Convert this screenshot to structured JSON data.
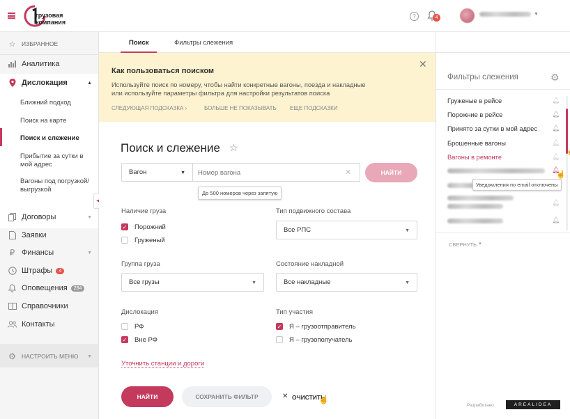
{
  "header": {
    "logo_line1": "грузовая",
    "logo_line2": "компания",
    "notification_count": "4"
  },
  "sidebar": {
    "favorites": "ИЗБРАННОЕ",
    "analytics": "Аналитика",
    "dislocation": "Дислокация",
    "sub": [
      "Ближний подход",
      "Поиск на карте",
      "Поиск и слежение",
      "Прибытие за сутки в мой адрес",
      "Вагоны под погрузкой/выгрузкой"
    ],
    "contracts": "Договоры",
    "requests": "Заявки",
    "finance": "Финансы",
    "fines": "Штрафы",
    "fines_count": "4",
    "alerts": "Оповещения",
    "alerts_count": "284",
    "reference": "Справочники",
    "contacts": "Контакты",
    "configure_menu": "НАСТРОИТЬ МЕНЮ"
  },
  "tabs": [
    "Поиск",
    "Фильтры слежения"
  ],
  "hint": {
    "title": "Как пользоваться поиском",
    "text1": "Используйте поиск по номеру, чтобы найти конкретные вагоны, поезда и накладные",
    "text2": "или используйте параметры фильтра для настройки результатов поиска",
    "next": "СЛЕДУЮЩАЯ ПОДСКАЗКА ›",
    "hide": "БОЛЬШЕ НЕ ПОКАЗЫВАТЬ",
    "more": "ЕЩЕ ПОДСКАЗКИ"
  },
  "search": {
    "title": "Поиск и слежение",
    "type_value": "Вагон",
    "placeholder": "Номер вагона",
    "find": "НАЙТИ",
    "tooltip": "До 500 номеров через запятую"
  },
  "form": {
    "cargo_presence_label": "Наличие груза",
    "cargo_empty": "Порожний",
    "cargo_loaded": "Груженый",
    "rolling_stock_label": "Тип подвижного состава",
    "rolling_stock_value": "Все РПС",
    "cargo_group_label": "Группа груза",
    "cargo_group_value": "Все грузы",
    "waybill_label": "Состояние накладной",
    "waybill_value": "Все накладные",
    "dislocation_label": "Дислокация",
    "disl_rf": "РФ",
    "disl_outside": "Вне РФ",
    "participation_label": "Тип участия",
    "part_sender": "Я – грузоотправитель",
    "part_receiver": "Я – грузополучатель",
    "refine_link": "Уточнить станции и дороги"
  },
  "actions": {
    "find": "НАЙТИ",
    "save": "СОХРАНИТЬ ФИЛЬТР",
    "clear": "ОЧИСТИТЬ"
  },
  "tracking": {
    "title": "Фильтры слежения",
    "items": [
      "Груженые в рейсе",
      "Порожние в рейсе",
      "Принято за сутки в мой адрес",
      "Брошенные вагоны",
      "Вагоны в ремонте"
    ],
    "tooltip": "Уведомления по email отключены",
    "collapse": "СВЕРНУТЬ",
    "developed_by": "Разработано",
    "developer": "AREALIDEA"
  },
  "colors": {
    "accent": "#c43a5d",
    "hint_bg": "#fdf3d0"
  }
}
